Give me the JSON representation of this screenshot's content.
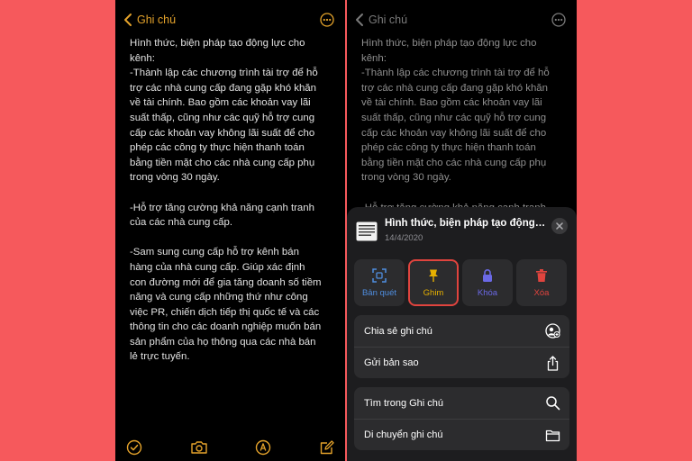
{
  "colors": {
    "background": "#f6595c",
    "accent": "#e5a32b",
    "pin": "#e6b000",
    "lock": "#6b69e6",
    "delete": "#e0443e",
    "scan": "#4f8ee0"
  },
  "left": {
    "back_label": "Ghi chú",
    "note_text": "Hình thức, biện pháp tạo động lực cho\nkênh:\n-Thành lập các chương trình tài trợ để hỗ\ntrợ các nhà cung cấp đang gặp khó khăn\nvề tài chính. Bao gồm các khoản vay lãi\nsuất thấp, cũng như các quỹ hỗ trợ cung\ncấp các khoản vay không lãi suất để cho\nphép các công ty thực hiện thanh toán\nbằng tiền mặt cho các nhà cung cấp phụ\ntrong vòng 30 ngày.\n\n-Hỗ trợ tăng cường khả năng cạnh tranh\ncủa các nhà cung cấp.\n\n-Sam sung cung cấp hỗ trợ kênh bán\nhàng của nhà cung cấp. Giúp xác định\ncon đường mới để gia tăng doanh số tiềm\nnăng và cung cấp những thứ như công\nviệc PR, chiến dịch tiếp thị quốc tế và các\nthông tin cho các doanh nghiệp muốn bán\nsản phẩm của họ thông qua các nhà bán\nlẻ trực tuyến."
  },
  "right": {
    "back_label": "Ghi chú",
    "note_text": "Hình thức, biện pháp tạo động lực cho\nkênh:\n-Thành lập các chương trình tài trợ để hỗ\ntrợ các nhà cung cấp đang gặp khó khăn\nvề tài chính. Bao gồm các khoản vay lãi\nsuất thấp, cũng như các quỹ hỗ trợ cung\ncấp các khoản vay không lãi suất để cho\nphép các công ty thực hiện thanh toán\nbằng tiền mặt cho các nhà cung cấp phụ\ntrong vòng 30 ngày.\n\n-Hỗ trợ tăng cường khả năng cạnh tranh",
    "sheet": {
      "title": "Hình thức, biện pháp tạo động lực cho kênh:",
      "date": "14/4/2020",
      "actions": [
        {
          "label": "Bản quét",
          "icon": "scan-icon"
        },
        {
          "label": "Ghim",
          "icon": "pin-icon"
        },
        {
          "label": "Khóa",
          "icon": "lock-icon"
        },
        {
          "label": "Xóa",
          "icon": "trash-icon"
        }
      ],
      "menu1": [
        {
          "label": "Chia sẻ ghi chú",
          "icon": "share-note-icon"
        },
        {
          "label": "Gửi bản sao",
          "icon": "share-icon"
        }
      ],
      "menu2": [
        {
          "label": "Tìm trong Ghi chú",
          "icon": "search-icon"
        },
        {
          "label": "Di chuyển ghi chú",
          "icon": "folder-icon"
        }
      ]
    }
  }
}
